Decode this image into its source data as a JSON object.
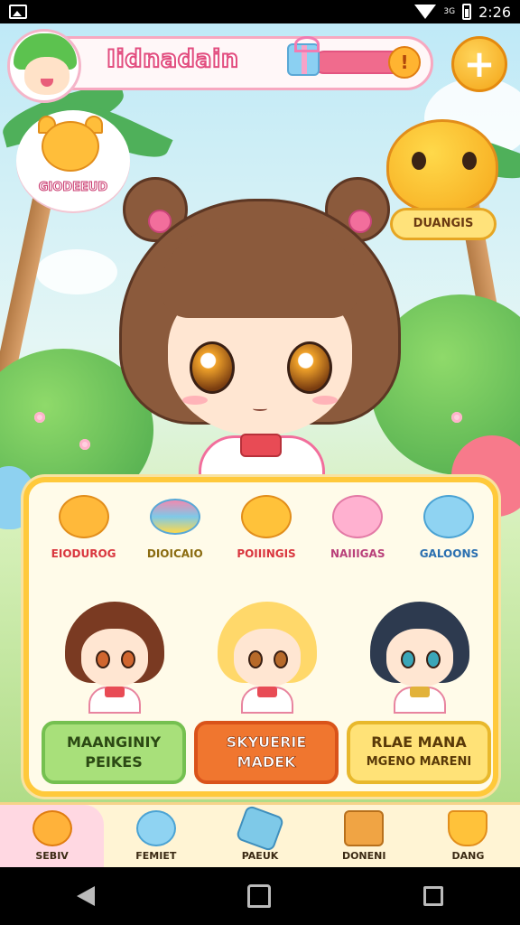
{
  "status_bar": {
    "time": "2:26",
    "signal": "3G"
  },
  "header": {
    "title": "Iidnadain",
    "alert_symbol": "!",
    "add_symbol": "+"
  },
  "badges": {
    "left_label": "GIODEEUD",
    "right_label": "DUANGIS"
  },
  "categories": [
    {
      "label": "EIODUROG",
      "color": "#ffb93a",
      "text_color": "#d9363e"
    },
    {
      "label": "DIOICAIO",
      "color": "#7ec9e8",
      "text_color": "#8a6b10"
    },
    {
      "label": "POIIINGIS",
      "color": "#ffc23a",
      "text_color": "#d9363e"
    },
    {
      "label": "NAIIIGAS",
      "color": "#ffb1d0",
      "text_color": "#b9407a"
    },
    {
      "label": "GALOONS",
      "color": "#8fd3f2",
      "text_color": "#2a6fb0"
    }
  ],
  "cards": [
    {
      "line1": "MAANGINIY",
      "line2": "PEIKES",
      "hair": "#7a3a22"
    },
    {
      "line1": "SKYUERIE",
      "line2": "MADEK",
      "hair": "#ffd86a"
    },
    {
      "line1": "RLAE MANA",
      "line2": "MGENO MARENI",
      "hair": "#2d3a4f"
    }
  ],
  "bottom_nav": [
    {
      "label": "SEBIV",
      "color": "#ffb23a"
    },
    {
      "label": "FEMIET",
      "color": "#8fd3f2"
    },
    {
      "label": "PAEUK",
      "color": "#7ec9e8"
    },
    {
      "label": "DONENI",
      "color": "#f0a444"
    },
    {
      "label": "DANG",
      "color": "#ffc23a"
    }
  ]
}
